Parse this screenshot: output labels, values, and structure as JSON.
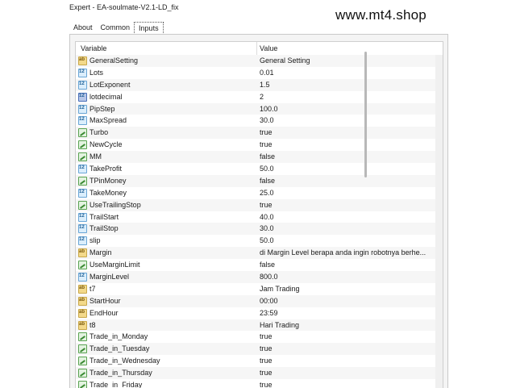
{
  "window": {
    "title": "Expert - EA-soulmate-V2.1-LD_fix"
  },
  "watermark": "www.mt4.shop",
  "tabs": [
    {
      "label": "About"
    },
    {
      "label": "Common"
    },
    {
      "label": "Inputs",
      "active": true
    }
  ],
  "table": {
    "headers": {
      "variable": "Variable",
      "value": "Value"
    },
    "rows": [
      {
        "name": "GeneralSetting",
        "value": "General Setting",
        "icon": "ab"
      },
      {
        "name": "Lots",
        "value": "0.01",
        "icon": "num"
      },
      {
        "name": "LotExponent",
        "value": "1.5",
        "icon": "num"
      },
      {
        "name": "lotdecimal",
        "value": "2",
        "icon": "num-dark"
      },
      {
        "name": "PipStep",
        "value": "100.0",
        "icon": "num"
      },
      {
        "name": "MaxSpread",
        "value": "30.0",
        "icon": "num"
      },
      {
        "name": "Turbo",
        "value": "true",
        "icon": "bool"
      },
      {
        "name": "NewCycle",
        "value": "true",
        "icon": "bool"
      },
      {
        "name": "MM",
        "value": "false",
        "icon": "bool"
      },
      {
        "name": "TakeProfit",
        "value": "50.0",
        "icon": "num"
      },
      {
        "name": "TPinMoney",
        "value": "false",
        "icon": "bool"
      },
      {
        "name": "TakeMoney",
        "value": "25.0",
        "icon": "num"
      },
      {
        "name": "UseTrailingStop",
        "value": "true",
        "icon": "bool"
      },
      {
        "name": "TrailStart",
        "value": "40.0",
        "icon": "num"
      },
      {
        "name": "TrailStop",
        "value": "30.0",
        "icon": "num"
      },
      {
        "name": "slip",
        "value": "50.0",
        "icon": "num"
      },
      {
        "name": "Margin",
        "value": "di Margin Level berapa anda ingin robotnya berhe...",
        "icon": "ab"
      },
      {
        "name": "UseMarginLimit",
        "value": "false",
        "icon": "bool"
      },
      {
        "name": "MarginLevel",
        "value": "800.0",
        "icon": "num"
      },
      {
        "name": "t7",
        "value": "Jam Trading",
        "icon": "ab"
      },
      {
        "name": "StartHour",
        "value": "00:00",
        "icon": "ab"
      },
      {
        "name": "EndHour",
        "value": "23:59",
        "icon": "ab"
      },
      {
        "name": "t8",
        "value": "Hari Trading",
        "icon": "ab"
      },
      {
        "name": "Trade_in_Monday",
        "value": "true",
        "icon": "bool"
      },
      {
        "name": "Trade_in_Tuesday",
        "value": "true",
        "icon": "bool"
      },
      {
        "name": "Trade_in_Wednesday",
        "value": "true",
        "icon": "bool"
      },
      {
        "name": "Trade_in_Thursday",
        "value": "true",
        "icon": "bool"
      },
      {
        "name": "Trade_in_Friday",
        "value": "true",
        "icon": "bool"
      }
    ]
  }
}
